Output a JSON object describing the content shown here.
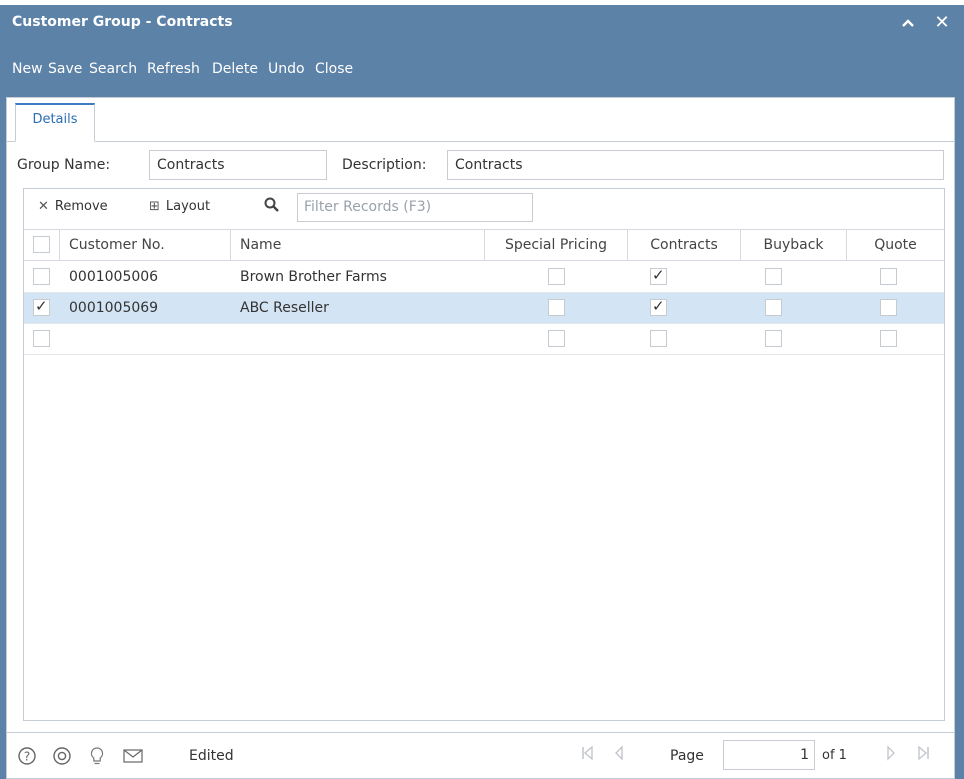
{
  "window": {
    "title": "Customer Group - Contracts",
    "collapse_glyph": "⌃",
    "close_glyph": "✕"
  },
  "toolbar": {
    "new": "New",
    "save": "Save",
    "search": "Search",
    "refresh": "Refresh",
    "delete": "Delete",
    "undo": "Undo",
    "close": "Close"
  },
  "tabs": [
    {
      "label": "Details",
      "active": true
    }
  ],
  "form": {
    "group_name_label": "Group Name:",
    "group_name_value": "Contracts",
    "description_label": "Description:",
    "description_value": "Contracts"
  },
  "grid": {
    "toolbar": {
      "remove_label": "Remove",
      "layout_label": "Layout",
      "filter_placeholder": "Filter Records (F3)"
    },
    "columns": [
      "Customer No.",
      "Name",
      "Special Pricing",
      "Contracts",
      "Buyback",
      "Quote"
    ],
    "rows": [
      {
        "selected": false,
        "customer_no": "0001005006",
        "name": "Brown Brother Farms",
        "special_pricing": false,
        "contracts": true,
        "buyback": false,
        "quote": false
      },
      {
        "selected": true,
        "customer_no": "0001005069",
        "name": "ABC Reseller",
        "special_pricing": false,
        "contracts": true,
        "buyback": false,
        "quote": false
      },
      {
        "selected": false,
        "customer_no": "",
        "name": "",
        "special_pricing": false,
        "contracts": false,
        "buyback": false,
        "quote": false
      }
    ]
  },
  "statusbar": {
    "status": "Edited",
    "page_label": "Page",
    "page_value": "1",
    "page_of": "of 1"
  },
  "icons": {
    "remove": "✕",
    "layout": "⊞",
    "filter": "🔍",
    "help": "?",
    "support": "◎",
    "idea": "💡",
    "mail": "✉",
    "first": "⏮",
    "prev": "◀",
    "next": "▶",
    "last": "⏭"
  },
  "colors": {
    "window_chrome": "#5d82a8",
    "tab_accent": "#3d7bc4",
    "selected_row": "#d3e4f5"
  }
}
